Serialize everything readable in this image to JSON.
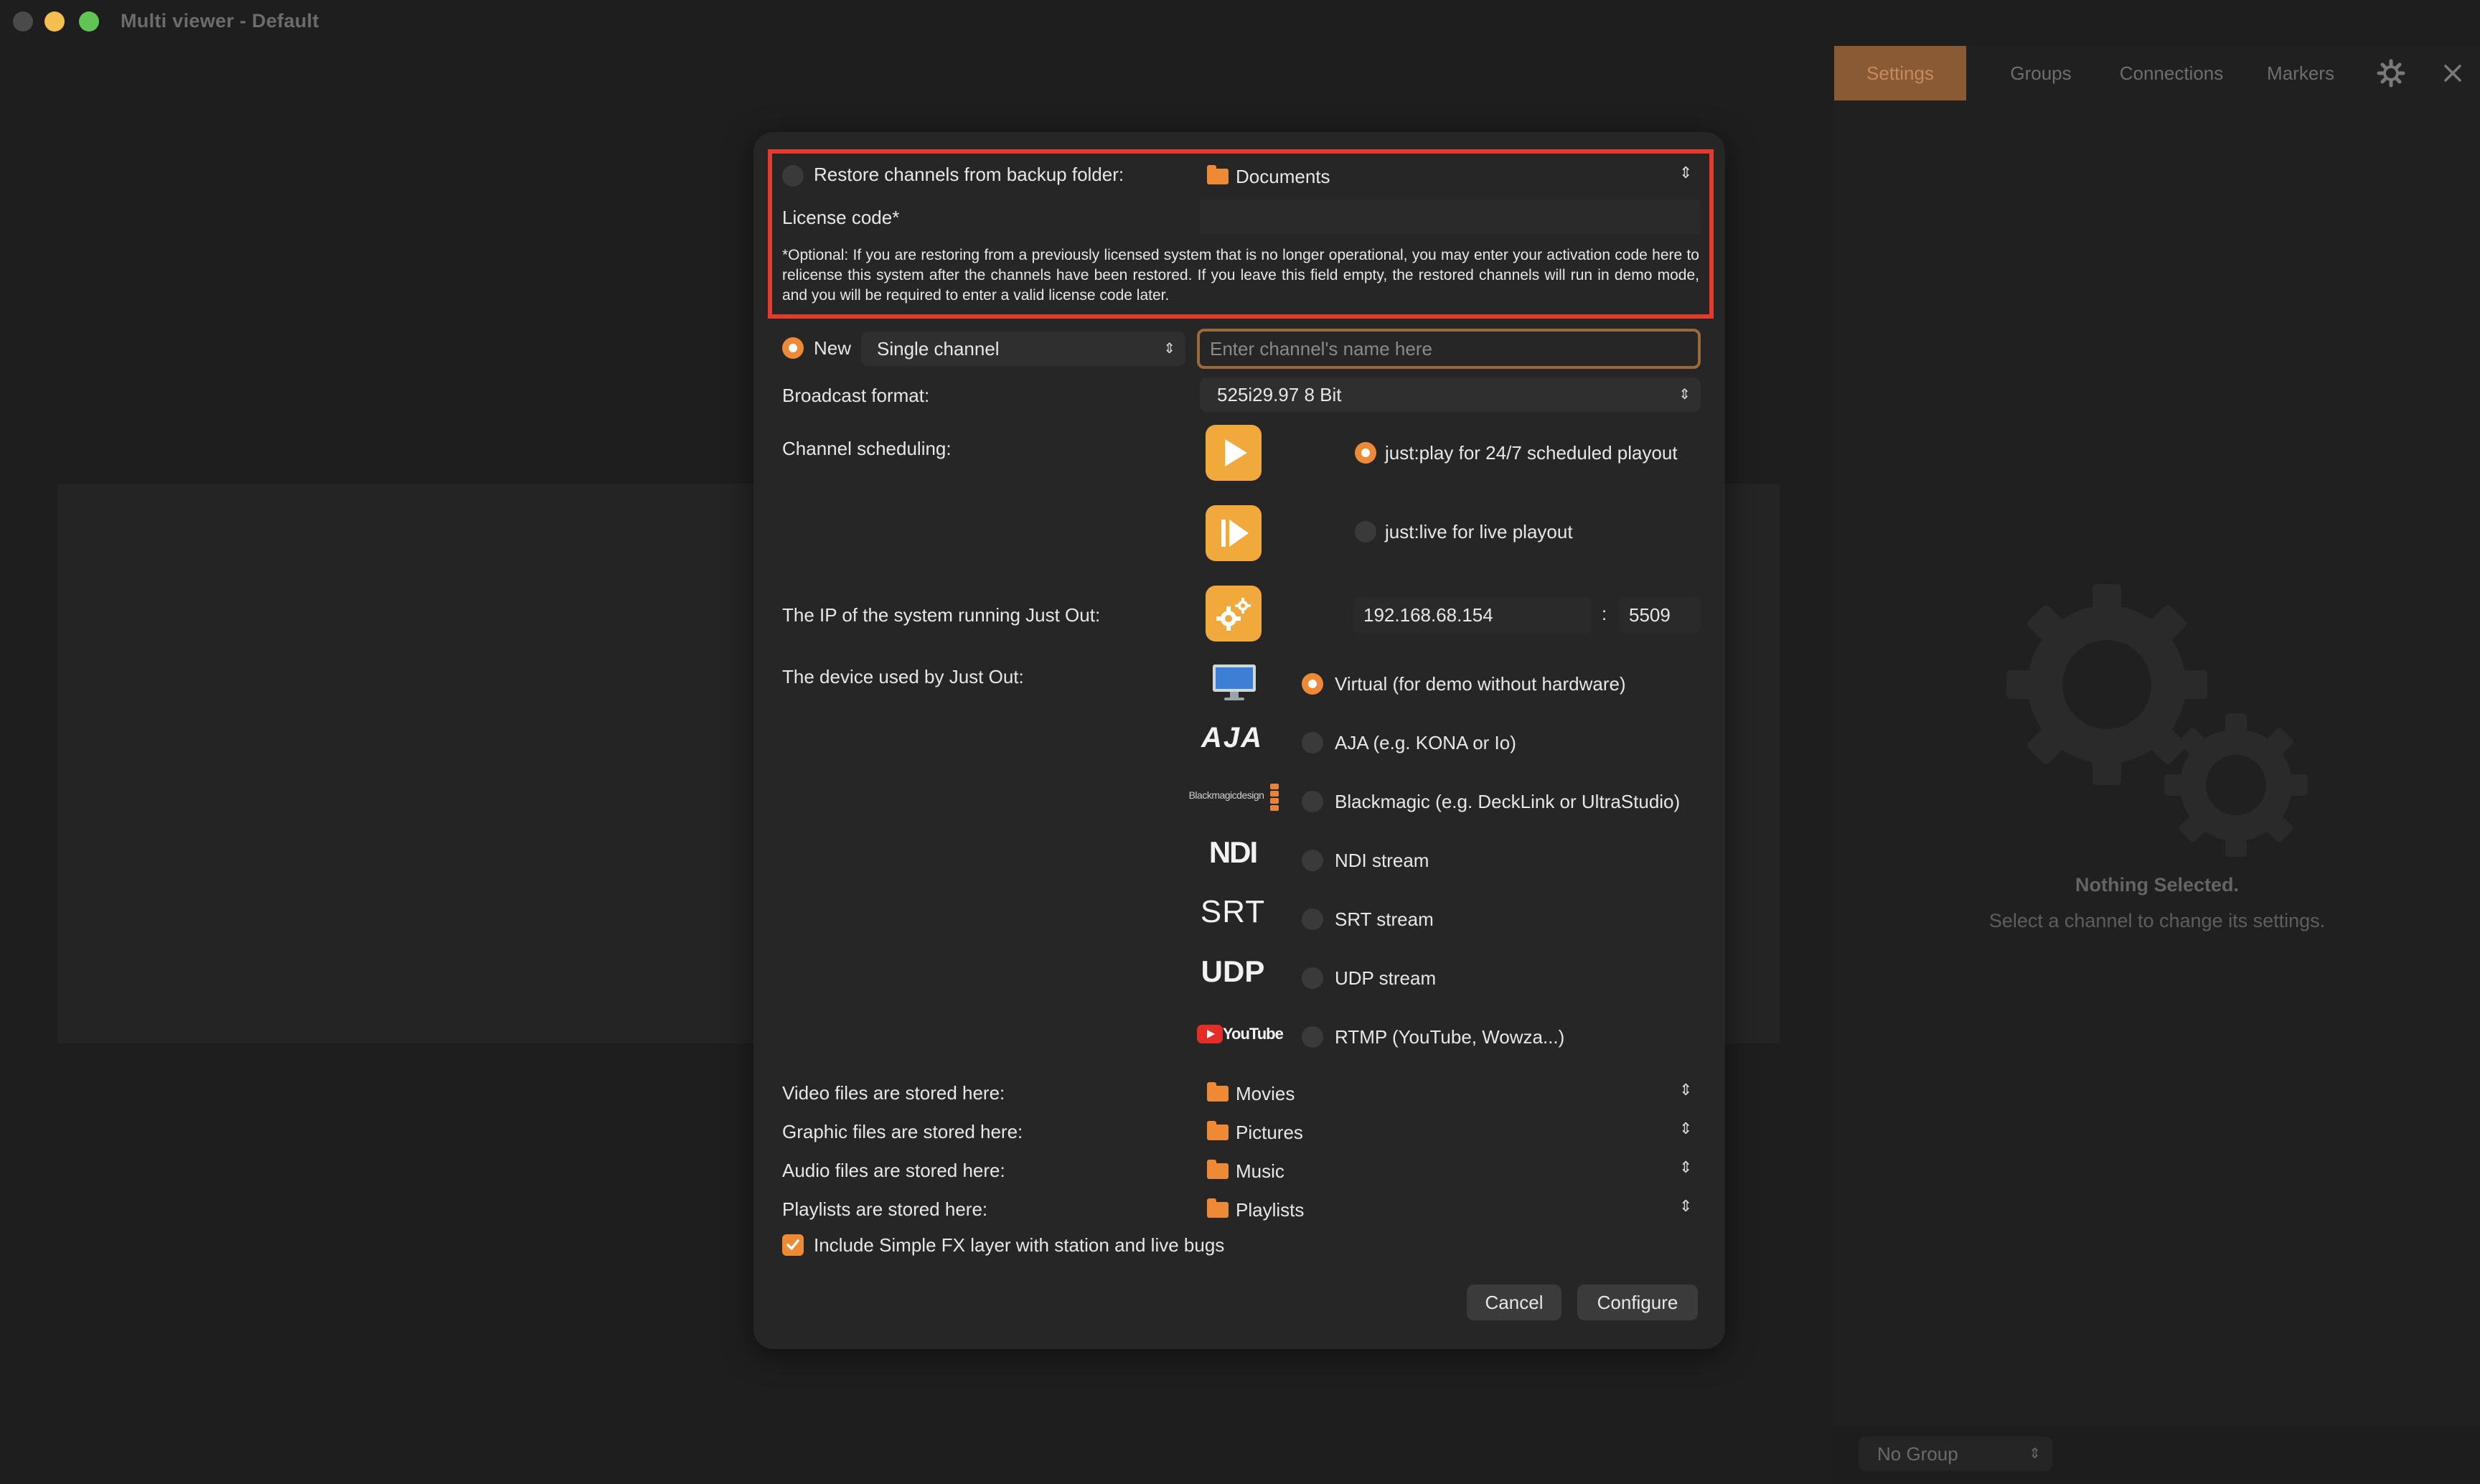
{
  "window": {
    "title": "Multi viewer - Default"
  },
  "sidebar": {
    "tabs": [
      {
        "label": "Settings",
        "active": true
      },
      {
        "label": "Groups",
        "active": false
      },
      {
        "label": "Connections",
        "active": false
      },
      {
        "label": "Markers",
        "active": false
      }
    ],
    "empty_title": "Nothing Selected.",
    "empty_subtitle": "Select a channel to change its settings.",
    "group_selector": "No Group"
  },
  "dialog": {
    "restore": {
      "label": "Restore channels from backup folder:",
      "folder": "Documents",
      "selected": false
    },
    "license": {
      "label": "License code*",
      "value": "",
      "note": "*Optional: If you are restoring from a previously licensed system that is no longer operational, you may enter your activation code here to relicense this system after the channels have been restored. If you leave this field empty, the restored channels will run in demo mode, and you will be required to enter a valid license code later."
    },
    "new_channel": {
      "label": "New",
      "selected": true,
      "type": "Single channel",
      "name_placeholder": "Enter channel's name here"
    },
    "broadcast_format": {
      "label": "Broadcast format:",
      "value": "525i29.97 8 Bit"
    },
    "scheduling": {
      "label": "Channel scheduling:",
      "options": [
        {
          "label": "just:play for 24/7 scheduled playout",
          "selected": true
        },
        {
          "label": "just:live for live playout",
          "selected": false
        }
      ]
    },
    "ip": {
      "label": "The IP of the system running Just Out:",
      "address": "192.168.68.154",
      "separator": ":",
      "port": "5509"
    },
    "device": {
      "label": "The device used by Just Out:",
      "options": [
        {
          "icon": "monitor-icon",
          "label": "Virtual (for demo without hardware)",
          "selected": true
        },
        {
          "icon": "aja-logo",
          "label": "AJA (e.g. KONA or Io)",
          "selected": false
        },
        {
          "icon": "blackmagic-logo",
          "label": "Blackmagic (e.g. DeckLink or UltraStudio)",
          "selected": false
        },
        {
          "icon": "ndi-logo",
          "label": "NDI stream",
          "selected": false
        },
        {
          "icon": "srt-logo",
          "label": "SRT stream",
          "selected": false
        },
        {
          "icon": "udp-logo",
          "label": "UDP stream",
          "selected": false
        },
        {
          "icon": "youtube-logo",
          "label": "RTMP (YouTube, Wowza...)",
          "selected": false
        }
      ],
      "logo_text": {
        "aja": "AJA",
        "blackmagic": "Blackmagicdesign",
        "ndi": "NDI",
        "srt": "SRT",
        "udp": "UDP",
        "youtube": "YouTube"
      }
    },
    "storage": [
      {
        "label": "Video files are stored here:",
        "folder": "Movies"
      },
      {
        "label": "Graphic files are stored here:",
        "folder": "Pictures"
      },
      {
        "label": "Audio files are stored here:",
        "folder": "Music"
      },
      {
        "label": "Playlists are stored here:",
        "folder": "Playlists"
      }
    ],
    "include_fx": {
      "label": "Include Simple FX layer with station and live bugs",
      "checked": true
    },
    "buttons": {
      "cancel": "Cancel",
      "configure": "Configure"
    }
  },
  "colors": {
    "accent": "#ee8a36",
    "highlight": "#e33b2e",
    "background": "#1e1e1e"
  }
}
